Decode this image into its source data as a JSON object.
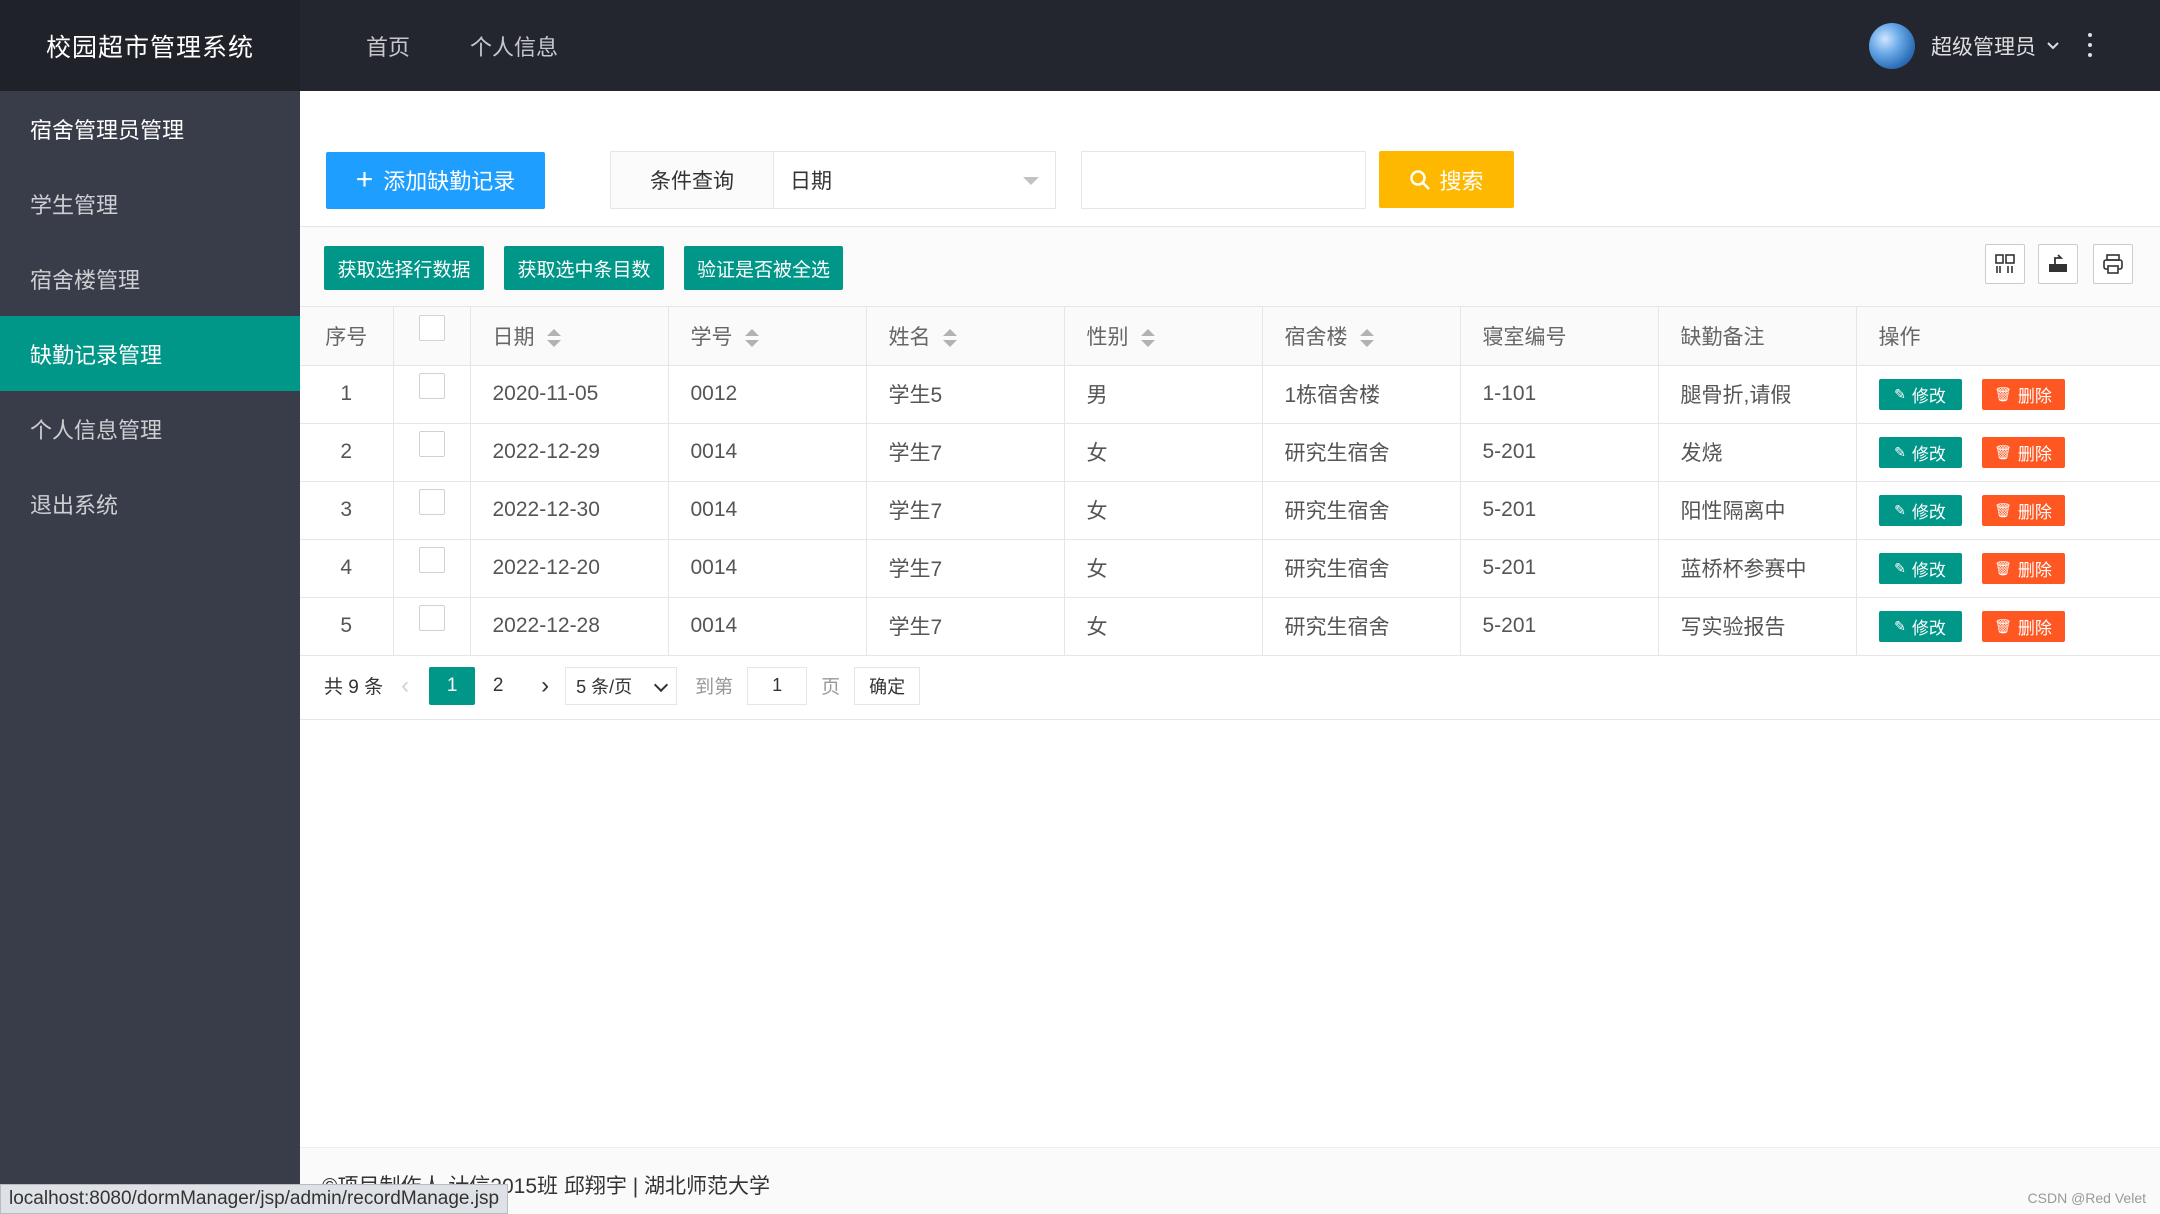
{
  "app": {
    "title": "校园超市管理系统"
  },
  "topnav": {
    "items": [
      "首页",
      "个人信息"
    ]
  },
  "user": {
    "name": "超级管理员"
  },
  "sidebar": {
    "items": [
      {
        "label": "宿舍管理员管理"
      },
      {
        "label": "学生管理"
      },
      {
        "label": "宿舍楼管理"
      },
      {
        "label": "缺勤记录管理",
        "active": true
      },
      {
        "label": "个人信息管理"
      },
      {
        "label": "退出系统"
      }
    ]
  },
  "actions": {
    "add_label": "添加缺勤记录",
    "condition_label": "条件查询",
    "condition_value": "日期",
    "search_label": "搜索",
    "search_value": ""
  },
  "toolbar": {
    "btn1": "获取选择行数据",
    "btn2": "获取选中条目数",
    "btn3": "验证是否被全选"
  },
  "table": {
    "headers": [
      "序号",
      "日期",
      "学号",
      "姓名",
      "性别",
      "宿舍楼",
      "寝室编号",
      "缺勤备注",
      "操作"
    ],
    "rows": [
      {
        "idx": "1",
        "date": "2020-11-05",
        "sno": "0012",
        "name": "学生5",
        "sex": "男",
        "building": "1栋宿舍楼",
        "room": "1-101",
        "note": "腿骨折,请假"
      },
      {
        "idx": "2",
        "date": "2022-12-29",
        "sno": "0014",
        "name": "学生7",
        "sex": "女",
        "building": "研究生宿舍",
        "room": "5-201",
        "note": "发烧"
      },
      {
        "idx": "3",
        "date": "2022-12-30",
        "sno": "0014",
        "name": "学生7",
        "sex": "女",
        "building": "研究生宿舍",
        "room": "5-201",
        "note": "阳性隔离中"
      },
      {
        "idx": "4",
        "date": "2022-12-20",
        "sno": "0014",
        "name": "学生7",
        "sex": "女",
        "building": "研究生宿舍",
        "room": "5-201",
        "note": "蓝桥杯参赛中"
      },
      {
        "idx": "5",
        "date": "2022-12-28",
        "sno": "0014",
        "name": "学生7",
        "sex": "女",
        "building": "研究生宿舍",
        "room": "5-201",
        "note": "写实验报告"
      }
    ],
    "edit_label": "修改",
    "delete_label": "删除"
  },
  "pager": {
    "total": "共 9 条",
    "pages": [
      "1",
      "2"
    ],
    "current": "1",
    "limit": "5 条/页",
    "skip_prefix": "到第",
    "skip_value": "1",
    "skip_suffix": "页",
    "confirm": "确定"
  },
  "footer": {
    "text": "©项目制作人 计信2015班 邱翔宇 | 湖北师范大学"
  },
  "status": {
    "url": "localhost:8080/dormManager/jsp/admin/recordManage.jsp"
  },
  "watermark": "CSDN @Red Velet",
  "colors": {
    "primary": "#009688",
    "blue": "#1e9fff",
    "warm": "#ffb800",
    "danger": "#ff5722",
    "header": "#23262e",
    "sidebar": "#393d49"
  }
}
